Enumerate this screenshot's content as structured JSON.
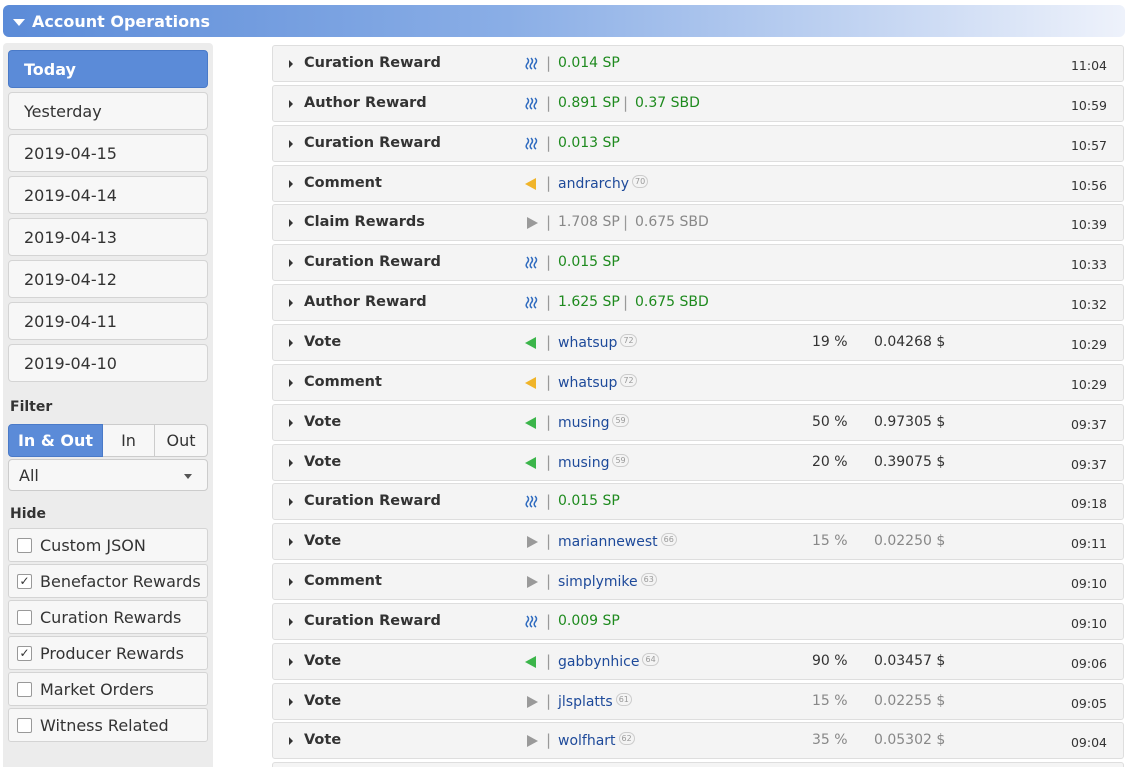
{
  "header": {
    "title": "Account Operations"
  },
  "sidebar": {
    "dates": [
      "Today",
      "Yesterday",
      "2019-04-15",
      "2019-04-14",
      "2019-04-13",
      "2019-04-12",
      "2019-04-11",
      "2019-04-10"
    ],
    "filter_label": "Filter",
    "segments": [
      "In & Out",
      "In",
      "Out"
    ],
    "select_value": "All",
    "hide_label": "Hide",
    "hide_items": [
      {
        "label": "Custom JSON",
        "checked": false
      },
      {
        "label": "Benefactor Rewards",
        "checked": true
      },
      {
        "label": "Curation Rewards",
        "checked": false
      },
      {
        "label": "Producer Rewards",
        "checked": true
      },
      {
        "label": "Market Orders",
        "checked": false
      },
      {
        "label": "Witness Related",
        "checked": false
      }
    ]
  },
  "colors": {
    "accent": "#5b8bd8",
    "green": "#1e8a1e",
    "link": "#1e4a9a",
    "vote_in": "#3bb54a",
    "comment": "#f0b429",
    "neutral": "#9a9a9a"
  },
  "operations": [
    {
      "op": "Curation Reward",
      "icon": "steem-icon",
      "v1": "0.014 SP",
      "v2": "",
      "time": "11:04"
    },
    {
      "op": "Author Reward",
      "icon": "steem-icon",
      "v1": "0.891 SP",
      "v2": "0.37 SBD",
      "time": "10:59"
    },
    {
      "op": "Curation Reward",
      "icon": "steem-icon",
      "v1": "0.013 SP",
      "v2": "",
      "time": "10:57"
    },
    {
      "op": "Comment",
      "icon": "comment-in-icon",
      "user": "andrarchy",
      "rep": "70",
      "time": "10:56"
    },
    {
      "op": "Claim Rewards",
      "icon": "out-icon",
      "v1": "1.708 SP",
      "v2": "0.675 SBD",
      "time": "10:39"
    },
    {
      "op": "Curation Reward",
      "icon": "steem-icon",
      "v1": "0.015 SP",
      "v2": "",
      "time": "10:33"
    },
    {
      "op": "Author Reward",
      "icon": "steem-icon",
      "v1": "1.625 SP",
      "v2": "0.675 SBD",
      "time": "10:32"
    },
    {
      "op": "Vote",
      "icon": "vote-in-icon",
      "user": "whatsup",
      "rep": "72",
      "pct": "19 %",
      "amt": "0.04268 $",
      "time": "10:29"
    },
    {
      "op": "Comment",
      "icon": "comment-in-icon",
      "user": "whatsup",
      "rep": "72",
      "time": "10:29"
    },
    {
      "op": "Vote",
      "icon": "vote-in-icon",
      "user": "musing",
      "rep": "59",
      "pct": "50 %",
      "amt": "0.97305 $",
      "time": "09:37"
    },
    {
      "op": "Vote",
      "icon": "vote-in-icon",
      "user": "musing",
      "rep": "59",
      "pct": "20 %",
      "amt": "0.39075 $",
      "time": "09:37"
    },
    {
      "op": "Curation Reward",
      "icon": "steem-icon",
      "v1": "0.015 SP",
      "v2": "",
      "time": "09:18"
    },
    {
      "op": "Vote",
      "icon": "out-icon",
      "user": "mariannewest",
      "rep": "66",
      "pct": "15 %",
      "amt": "0.02250 $",
      "time": "09:11"
    },
    {
      "op": "Comment",
      "icon": "out-icon",
      "user": "simplymike",
      "rep": "63",
      "time": "09:10"
    },
    {
      "op": "Curation Reward",
      "icon": "steem-icon",
      "v1": "0.009 SP",
      "v2": "",
      "time": "09:10"
    },
    {
      "op": "Vote",
      "icon": "vote-in-icon",
      "user": "gabbynhice",
      "rep": "64",
      "pct": "90 %",
      "amt": "0.03457 $",
      "time": "09:06"
    },
    {
      "op": "Vote",
      "icon": "out-icon",
      "user": "jlsplatts",
      "rep": "61",
      "pct": "15 %",
      "amt": "0.02255 $",
      "time": "09:05"
    },
    {
      "op": "Vote",
      "icon": "out-icon",
      "user": "wolfhart",
      "rep": "62",
      "pct": "35 %",
      "amt": "0.05302 $",
      "time": "09:04"
    }
  ]
}
